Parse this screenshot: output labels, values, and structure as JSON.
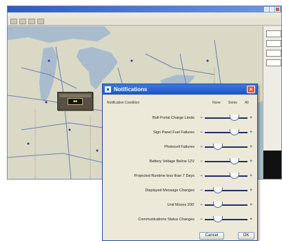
{
  "app": {
    "title": "",
    "menu": [
      "",
      "",
      ""
    ],
    "colors": {
      "titlebar": "#2c5bc4",
      "map_land": "#d9d9c5",
      "water": "#9fb4c8",
      "road": "#5c6fa8"
    }
  },
  "map_popup": {
    "badge_text": "■■"
  },
  "dialog": {
    "title": "Notifications",
    "close_icon": "close-icon",
    "header": {
      "condition": "Notification Condition",
      "none": "None",
      "some": "Some",
      "all": "All"
    },
    "rows": [
      {
        "label": "Bolt Portal Charge Limits",
        "level": 0.75
      },
      {
        "label": "Sign Panel Fuel Failures",
        "level": 0.75
      },
      {
        "label": "Photocell Failures",
        "level": 0.25
      },
      {
        "label": "Battery Voltage Below 12V",
        "level": 0.75
      },
      {
        "label": "Projected Runtime less than 7 Days",
        "level": 0.75
      },
      {
        "label": "Displayed Message Changes",
        "level": 0.25
      },
      {
        "label": "Unit Moves 200'",
        "level": 0.25
      },
      {
        "label": "Communications Status Changes",
        "level": 0.25
      }
    ],
    "cancel_label": "Cancel",
    "ok_label": "OK"
  }
}
